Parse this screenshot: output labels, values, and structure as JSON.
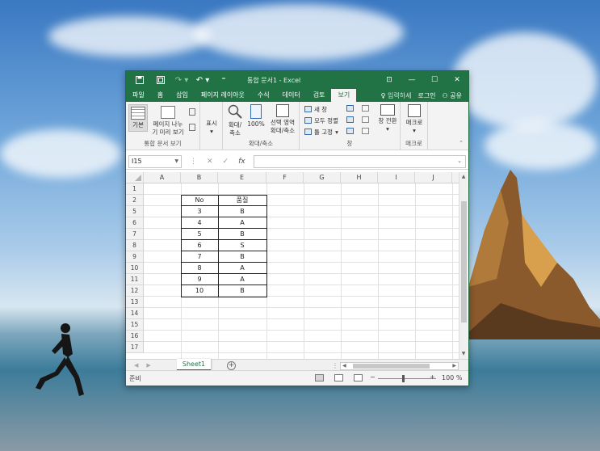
{
  "window": {
    "title": "통합 문서1 - Excel"
  },
  "quick_access": {
    "save_icon": "save-icon",
    "touch_icon": "touch-mode-icon",
    "redo_icon": "redo-icon",
    "undo_icon": "undo-icon",
    "customize_icon": "customize-icon"
  },
  "window_controls": {
    "ribbon_options": "⊡",
    "minimize": "—",
    "maximize": "☐",
    "close": "✕"
  },
  "tabs": [
    {
      "label": "파일",
      "active": false
    },
    {
      "label": "홈",
      "active": false
    },
    {
      "label": "삽입",
      "active": false
    },
    {
      "label": "페이지 레이아웃",
      "active": false
    },
    {
      "label": "수식",
      "active": false
    },
    {
      "label": "데이터",
      "active": false
    },
    {
      "label": "검토",
      "active": false
    },
    {
      "label": "보기",
      "active": true
    }
  ],
  "tell_me": "입력하세",
  "login": "로그인",
  "share": "공유",
  "ribbon": {
    "workbook_views": {
      "normal": "기본",
      "page_break_line1": "페이지 나누",
      "page_break_line2": "기 미리 보기",
      "group_label": "통합 문서 보기"
    },
    "show": {
      "label": "표시"
    },
    "zoom": {
      "zoom_line1": "확대/",
      "zoom_line2": "축소",
      "hundred": "100%",
      "sel_line1": "선택 영역",
      "sel_line2": "확대/축소",
      "group_label": "확대/축소"
    },
    "window": {
      "new_window": "새 창",
      "arrange_all": "모두 정렬",
      "freeze": "틀 고정",
      "switch_windows": "창 전환",
      "group_label": "창"
    },
    "macros": {
      "label": "매크로",
      "group_label": "매크로"
    }
  },
  "formula_bar": {
    "name_box": "I15",
    "fx": "fx",
    "value": ""
  },
  "columns": [
    "A",
    "B",
    "E",
    "F",
    "G",
    "H",
    "I",
    "J"
  ],
  "rows": [
    "1",
    "2",
    "5",
    "6",
    "7",
    "8",
    "9",
    "10",
    "11",
    "12",
    "13",
    "14",
    "15",
    "16",
    "17"
  ],
  "table": {
    "header": [
      "No",
      "품질"
    ],
    "rows": [
      [
        "3",
        "B"
      ],
      [
        "4",
        "A"
      ],
      [
        "5",
        "B"
      ],
      [
        "6",
        "S"
      ],
      [
        "7",
        "B"
      ],
      [
        "8",
        "A"
      ],
      [
        "9",
        "A"
      ],
      [
        "10",
        "B"
      ]
    ]
  },
  "sheet_tab": "Sheet1",
  "status": {
    "ready": "준비",
    "zoom": "100 %",
    "zoom_level_percent": 100
  }
}
